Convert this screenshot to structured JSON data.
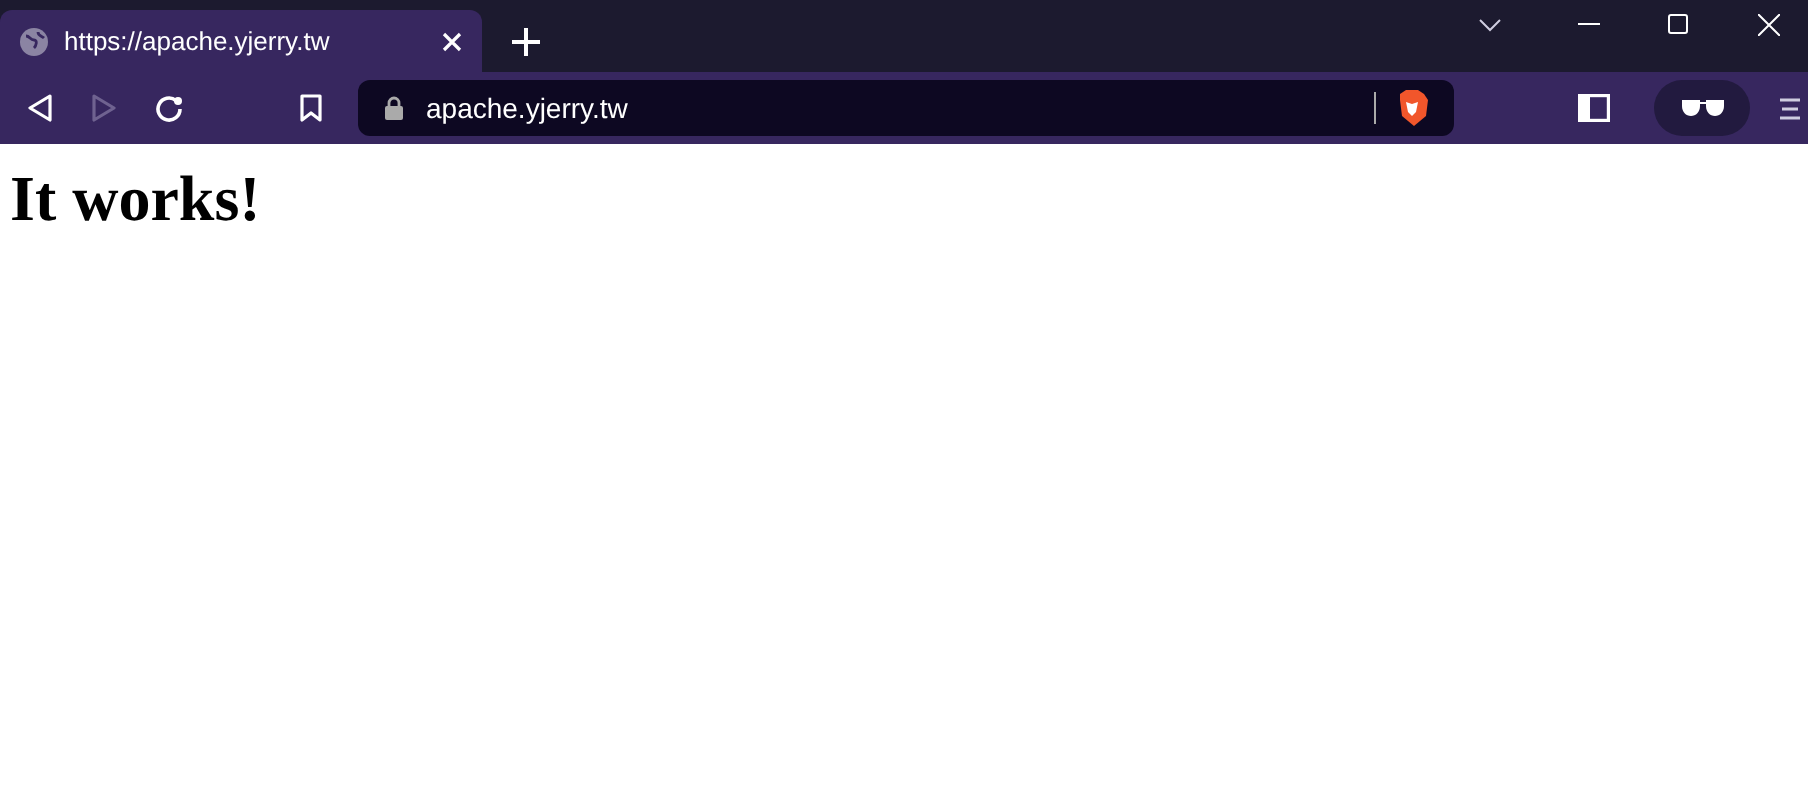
{
  "tabs": [
    {
      "title": "https://apache.yjerry.tw",
      "selected": true
    }
  ],
  "toolbar": {
    "back_disabled": false,
    "forward_disabled": true
  },
  "address_bar": {
    "url": "apache.yjerry.tw"
  },
  "page": {
    "heading": "It works!"
  }
}
